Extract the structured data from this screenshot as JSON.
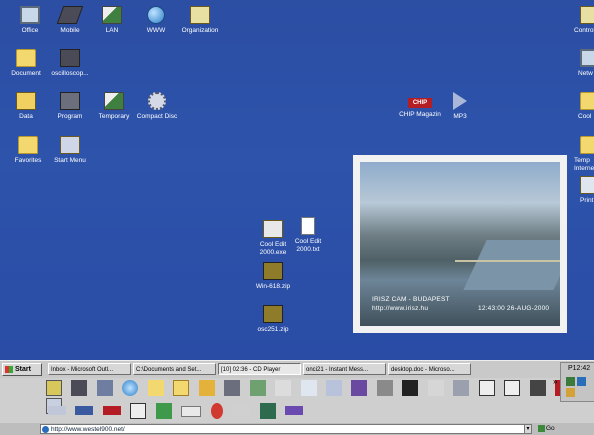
{
  "desktop": {
    "icons": [
      {
        "label": "Office",
        "glyph": "monitor-icon"
      },
      {
        "label": "Mobile",
        "glyph": "laptop-icon"
      },
      {
        "label": "LAN",
        "glyph": "network-icon"
      },
      {
        "label": "WWW",
        "glyph": "globe-icon"
      },
      {
        "label": "Organization",
        "glyph": "organizer-icon"
      },
      {
        "label": "Document",
        "glyph": "folder-icon"
      },
      {
        "label": "oscilloscop...",
        "glyph": "oscilloscope-icon"
      },
      {
        "label": "Data",
        "glyph": "data-icon"
      },
      {
        "label": "Program",
        "glyph": "program-icon"
      },
      {
        "label": "Temporary",
        "glyph": "temporary-icon"
      },
      {
        "label": "Compact Disc",
        "glyph": "cd-icon"
      },
      {
        "label": "Favorites",
        "glyph": "favorites-icon"
      },
      {
        "label": "Start Menu",
        "glyph": "start-menu-icon"
      },
      {
        "label": "CHIP Magazin",
        "glyph": "chip-logo-icon"
      },
      {
        "label": "MP3",
        "glyph": "play-icon"
      },
      {
        "label": "Cool Edit 2000.exe",
        "glyph": "cool-edit-icon"
      },
      {
        "label": "Cool Edit 2000.txt",
        "glyph": "text-file-icon"
      },
      {
        "label": "Win-618.zip",
        "glyph": "zip-icon"
      },
      {
        "label": "osc251.zip",
        "glyph": "zip-icon"
      },
      {
        "label": "Control",
        "glyph": "control-panel-icon"
      },
      {
        "label": "Netw",
        "glyph": "network-neighborhood-icon"
      },
      {
        "label": "Cool",
        "glyph": "cool-icon"
      },
      {
        "label": "Temp Interne",
        "glyph": "temp-internet-icon"
      },
      {
        "label": "Print",
        "glyph": "printer-icon"
      }
    ],
    "chip_logo_text": "CHIP"
  },
  "webcam": {
    "caption_line1": "IRISZ CAM - BUDAPEST",
    "caption_line2": "http://www.irisz.hu",
    "timestamp": "12:43:00 26-AUG-2000"
  },
  "taskbar": {
    "start_label": "Start",
    "tasks": [
      {
        "label": "Inbox - Microsoft Outl..."
      },
      {
        "label": "C:\\Documents and Set..."
      },
      {
        "label": "[10] 02:36 - CD Player"
      },
      {
        "label": "onci21 - Instant Mess..."
      },
      {
        "label": "desktop.doc - Microso..."
      }
    ],
    "clock": "P12:42",
    "chevron": "»"
  },
  "address_bar": {
    "url": "http://www.westel900.net/",
    "go_label": "Go",
    "dropdown_glyph": "▾"
  }
}
